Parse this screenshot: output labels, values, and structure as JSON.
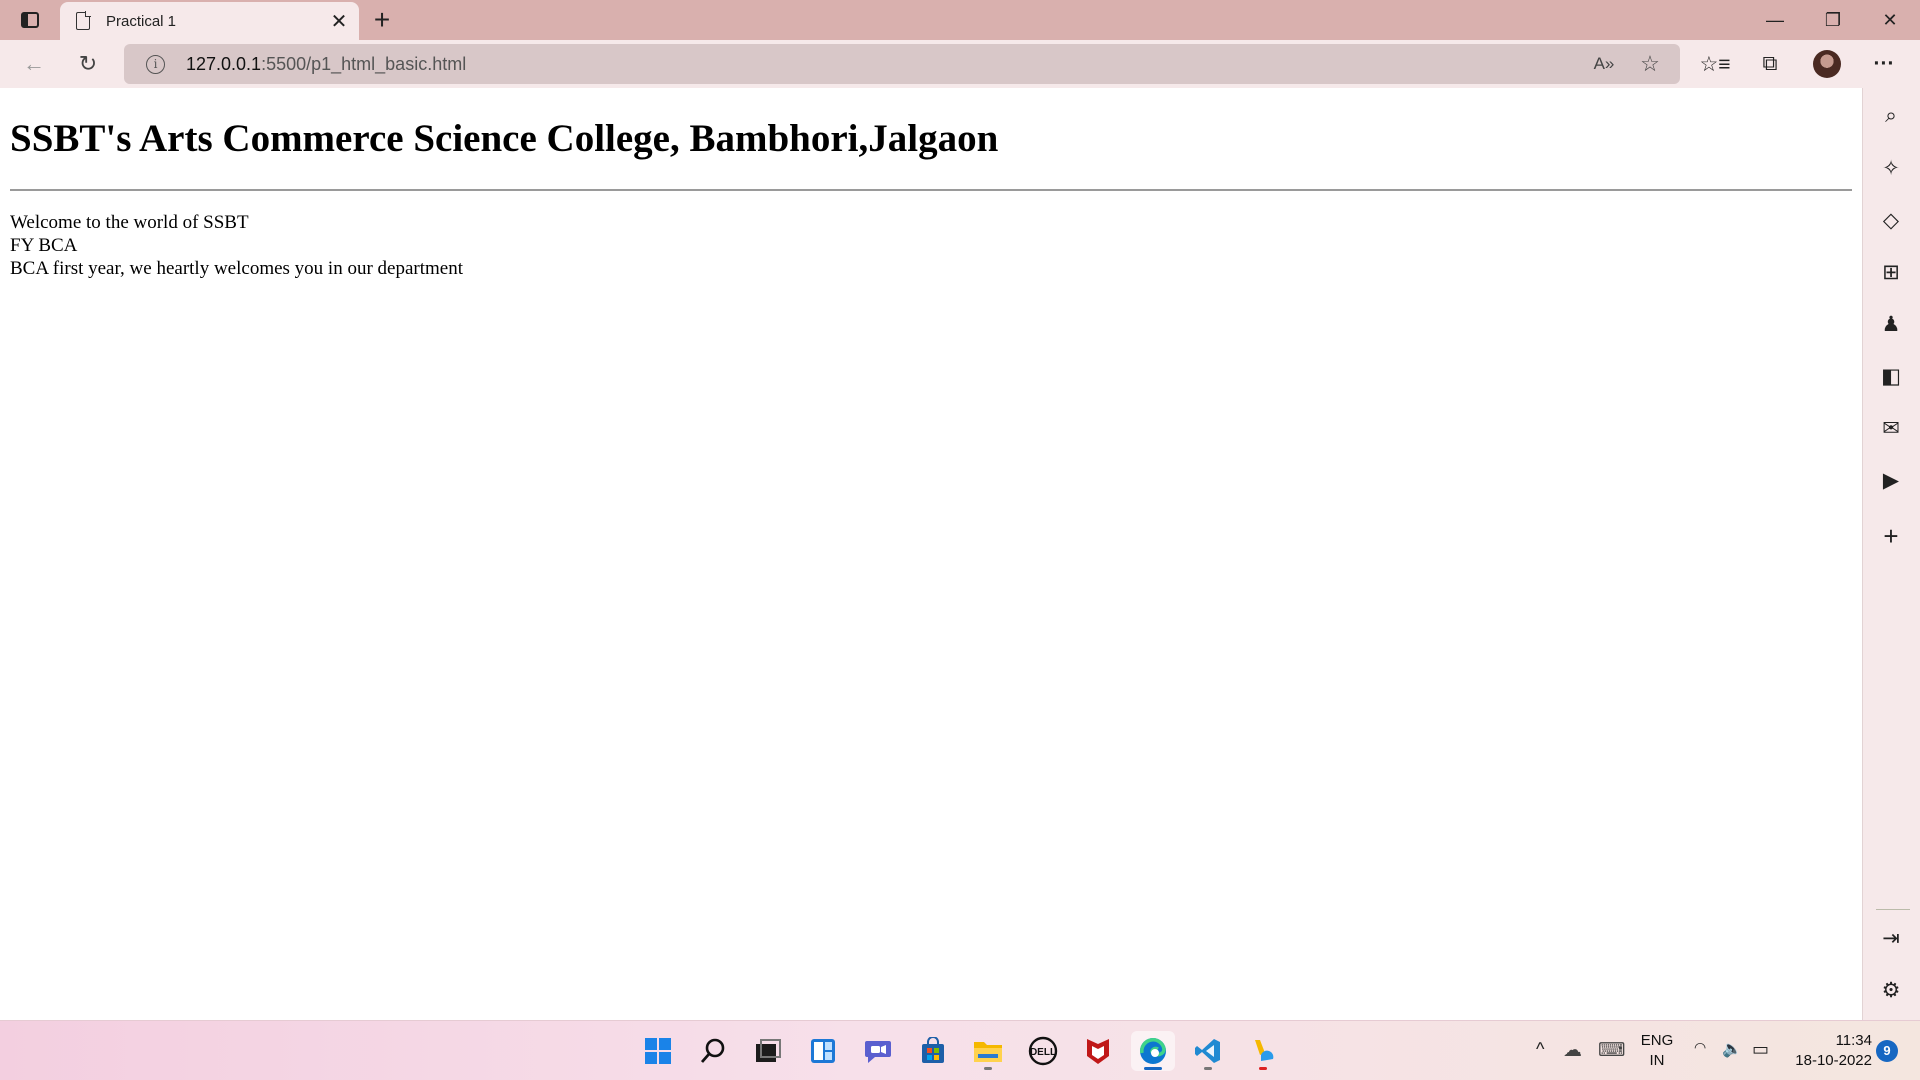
{
  "browser": {
    "tab": {
      "title": "Practical 1",
      "close_glyph": "✕",
      "icon": "page-icon"
    },
    "new_tab_glyph": "+",
    "window_controls": {
      "minimize": "—",
      "restore": "❐",
      "close": "✕"
    },
    "address": {
      "host": "127.0.0.1",
      "path": ":5500/p1_html_basic.html"
    },
    "toolbar_glyphs": {
      "back": "←",
      "refresh": "↻",
      "read_aloud": "A»",
      "add_favorite": "☆",
      "favorites": "☆≡",
      "collections": "⧉",
      "menu": "···"
    }
  },
  "page": {
    "heading": "SSBT's Arts Commerce Science College, Bambhori,Jalgaon",
    "lines": [
      "Welcome to the world of SSBT",
      "FY BCA",
      "BCA first year, we heartly welcomes you in our department"
    ]
  },
  "sidebar": {
    "glyphs": {
      "search": "⌕",
      "copilot": "✧",
      "shopping": "◇",
      "tools": "⊞",
      "games": "♟",
      "office": "◧",
      "outlook": "✉",
      "youtube": "▶",
      "add": "+",
      "hide": "⇥",
      "settings": "⚙"
    }
  },
  "taskbar": {
    "language": {
      "line1": "ENG",
      "line2": "IN"
    },
    "time": "11:34",
    "date": "18-10-2022",
    "notification_count": "9",
    "tray_glyphs": {
      "chevron": "^",
      "cloud": "☁",
      "keyboard": "⌨",
      "wifi": "◠",
      "volume": "🔈",
      "battery": "▭"
    }
  }
}
